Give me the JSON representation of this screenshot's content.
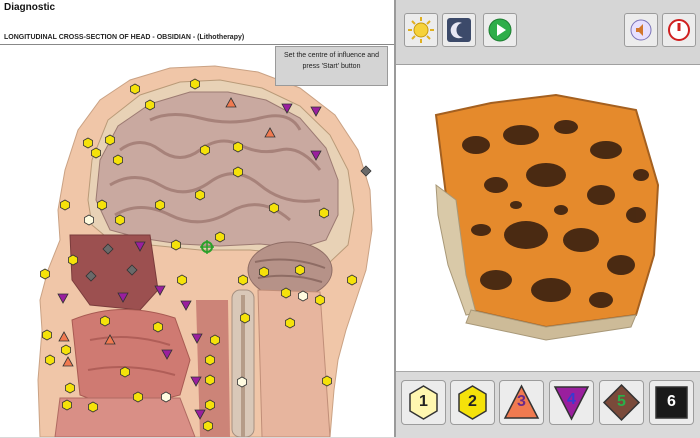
{
  "window": {
    "title": "Diagnostic"
  },
  "view": {
    "subtitle": "LONGITUDINAL CROSS-SECTION OF HEAD - OBSIDIAN - (Lithotherapy)"
  },
  "hint": {
    "line1": "Set the centre of influence and",
    "line2": "press 'Start' button"
  },
  "toolbar": {
    "icons": [
      "sun-icon",
      "moon-icon",
      "play-icon",
      "audio-icon",
      "power-icon"
    ]
  },
  "levels": [
    {
      "num": "1",
      "shape": "hexagon",
      "color": "#fff7b0"
    },
    {
      "num": "2",
      "shape": "hexagon",
      "color": "#f5e20a"
    },
    {
      "num": "3",
      "shape": "triangle",
      "color": "#f07a50"
    },
    {
      "num": "4",
      "shape": "inverted-triangle",
      "color": "#9a1f9e"
    },
    {
      "num": "5",
      "shape": "diamond",
      "color": "#7a4a3a"
    },
    {
      "num": "6",
      "shape": "square",
      "color": "#1a1a1a"
    }
  ]
}
